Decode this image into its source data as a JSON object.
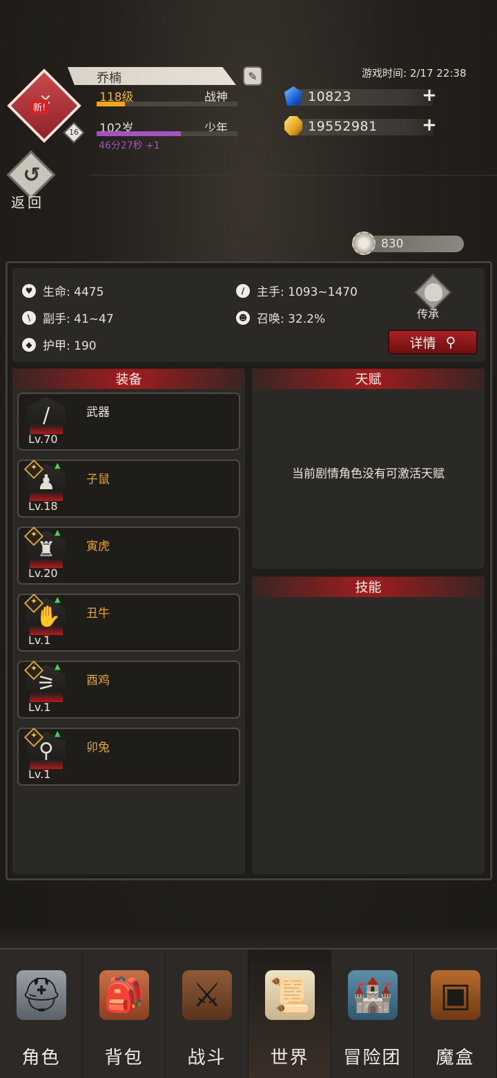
{
  "header": {
    "player_name": "乔楠",
    "avatar_tag": "新!",
    "avatar_level": "16",
    "level": "118级",
    "level_progress": 0.2,
    "title": "战神",
    "age": "102岁",
    "age_stage": "少年",
    "age_progress": 0.6,
    "age_timer": "46分27秒 +1",
    "game_time": "游戏时间: 2/17 22:38",
    "diamonds": "10823",
    "gold": "19552981",
    "back_label": "返回",
    "power": "830"
  },
  "stats": {
    "hp": "生命: 4475",
    "main_hand": "主手: 1093~1470",
    "off_hand": "副手: 41~47",
    "summon": "召唤: 32.2%",
    "armor": "护甲: 190",
    "inherit_label": "传承",
    "detail_label": "详情"
  },
  "equipment": {
    "title": "装备",
    "items": [
      {
        "name": "武器",
        "level": "Lv.70",
        "name_color": "#ece6da",
        "glyph": "/"
      },
      {
        "name": "子鼠",
        "level": "Lv.18",
        "name_color": "#e8a23a",
        "glyph": "♟"
      },
      {
        "name": "寅虎",
        "level": "Lv.20",
        "name_color": "#e8a23a",
        "glyph": "♜"
      },
      {
        "name": "丑牛",
        "level": "Lv.1",
        "name_color": "#e8a23a",
        "glyph": "✋"
      },
      {
        "name": "酉鸡",
        "level": "Lv.1",
        "name_color": "#e8a23a",
        "glyph": "⚞"
      },
      {
        "name": "卯兔",
        "level": "Lv.1",
        "name_color": "#e8a23a",
        "glyph": "⚲"
      }
    ]
  },
  "talent": {
    "title": "天赋",
    "message": "当前剧情角色没有可激活天赋"
  },
  "skills": {
    "title": "技能"
  },
  "nav": {
    "items": [
      {
        "label": "角色",
        "icon": "helmet-icon",
        "active": false
      },
      {
        "label": "背包",
        "icon": "backpack-icon",
        "active": false
      },
      {
        "label": "战斗",
        "icon": "sword-shield-icon",
        "active": false
      },
      {
        "label": "世界",
        "icon": "scroll-icon",
        "active": true
      },
      {
        "label": "冒险团",
        "icon": "castle-icon",
        "active": false
      },
      {
        "label": "魔盒",
        "icon": "magic-box-icon",
        "active": false
      }
    ]
  },
  "colors": {
    "accent_red": "#a11c1f",
    "level_gold": "#f0b23a",
    "age_purple": "#a552c4"
  }
}
